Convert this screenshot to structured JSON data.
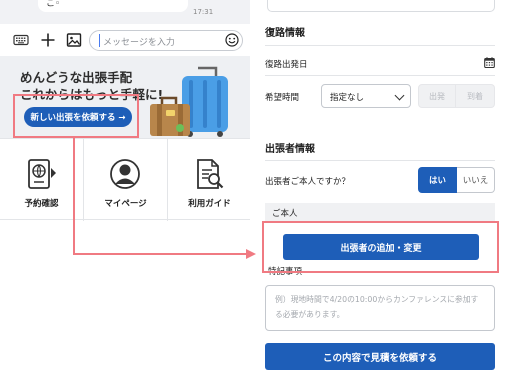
{
  "chat": {
    "bubble_text": "こ◦",
    "time": "17:31",
    "input_placeholder": "メッセージを入力"
  },
  "banner": {
    "title_line1": "めんどうな出張手配",
    "title_line2": "これからはもっと手軽に!",
    "button_label": "新しい出張を依頼する →"
  },
  "menu": {
    "items": [
      {
        "label": "予約確認",
        "icon": "passport-icon"
      },
      {
        "label": "マイページ",
        "icon": "user-avatar-icon"
      },
      {
        "label": "利用ガイド",
        "icon": "guide-document-icon"
      }
    ]
  },
  "form": {
    "return_section_title": "復路情報",
    "return_date_label": "復路出発日",
    "time_label": "希望時間",
    "time_select_value": "指定なし",
    "depart_label": "出発",
    "arrive_label": "到着",
    "traveler_section_title": "出張者情報",
    "self_question": "出張者ご本人ですか？",
    "yes_label": "はい",
    "no_label": "いいえ",
    "self_band_label": "ご本人",
    "add_button_label": "出張者の追加・変更",
    "notes_label": "特記事項",
    "notes_placeholder": "例）現地時間で4/20の10:00からカンファレンスに参加する必要があります。",
    "submit_label": "この内容で見積を依頼する"
  },
  "colors": {
    "primary": "#1e5eb8",
    "highlight": "#f07a82"
  }
}
